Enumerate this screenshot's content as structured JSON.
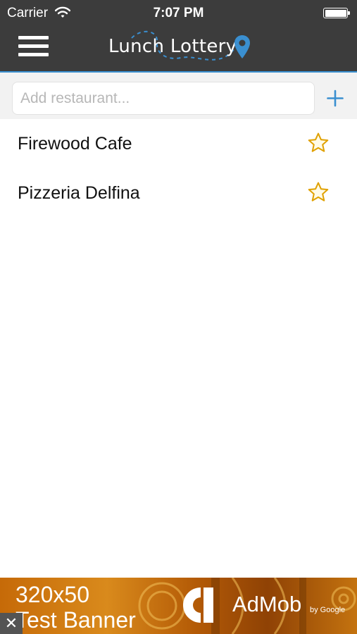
{
  "status_bar": {
    "carrier": "Carrier",
    "time": "7:07 PM",
    "wifi_icon": "wifi-icon",
    "battery_icon": "battery-icon",
    "battery_level": 1.0
  },
  "header": {
    "app_title": "Lunch Lottery",
    "menu_icon": "hamburger-menu-icon",
    "logo_icon": "map-pin-icon"
  },
  "search": {
    "placeholder": "Add restaurant...",
    "value": "",
    "add_icon": "plus-icon"
  },
  "restaurants": [
    {
      "name": "Firewood Cafe",
      "favorite": false,
      "icon": "star-outline-icon"
    },
    {
      "name": "Pizzeria Delfina",
      "favorite": false,
      "icon": "star-outline-icon"
    }
  ],
  "ad_banner": {
    "size_text": "320x50",
    "title": "Test Banner",
    "brand": "AdMob",
    "by_text": "by Google",
    "close_icon": "close-icon",
    "close_glyph": "✕"
  },
  "colors": {
    "header_background": "#3c3c3c",
    "accent_blue": "#3a8fd0",
    "star_gold": "#e0a100",
    "ad_orange": "#c66a08"
  }
}
